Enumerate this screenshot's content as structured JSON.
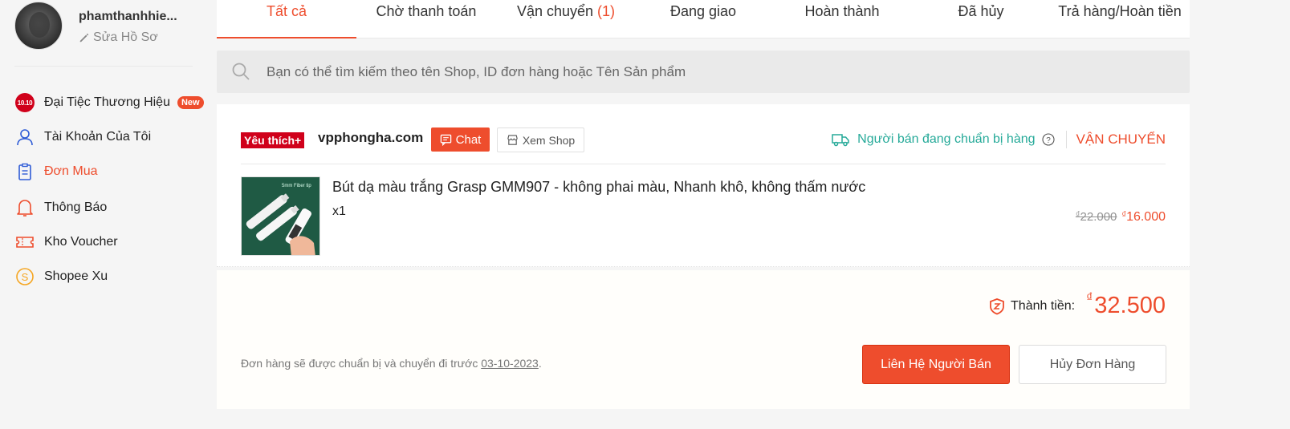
{
  "profile": {
    "username": "phamthanhhie...",
    "edit_label": "Sửa Hồ Sơ"
  },
  "sidebar": {
    "items": [
      {
        "label": "Đại Tiệc Thương Hiệu",
        "icon": "10-10-icon",
        "badge": "New",
        "badge_1010_text": "10.10"
      },
      {
        "label": "Tài Khoản Của Tôi",
        "icon": "user-icon"
      },
      {
        "label": "Đơn Mua",
        "icon": "clipboard-icon",
        "active": true
      },
      {
        "label": "Thông Báo",
        "icon": "bell-icon"
      },
      {
        "label": "Kho Voucher",
        "icon": "voucher-icon"
      },
      {
        "label": "Shopee Xu",
        "icon": "coin-icon"
      }
    ]
  },
  "tabs": [
    {
      "label": "Tất cả",
      "active": true
    },
    {
      "label": "Chờ thanh toán"
    },
    {
      "label": "Vận chuyển",
      "count": "(1)"
    },
    {
      "label": "Đang giao"
    },
    {
      "label": "Hoàn thành"
    },
    {
      "label": "Đã hủy"
    },
    {
      "label": "Trả hàng/Hoàn tiền"
    }
  ],
  "search": {
    "placeholder": "Bạn có thể tìm kiếm theo tên Shop, ID đơn hàng hoặc Tên Sản phẩm"
  },
  "order": {
    "favorite_badge": "Yêu thích+",
    "shop_name": "vpphongha.com",
    "chat_label": "Chat",
    "view_shop_label": "Xem Shop",
    "status_text": "Người bán đang chuẩn bị hàng",
    "status_label": "VẬN CHUYỂN",
    "product": {
      "name": "Bút dạ màu trắng Grasp GMM907 - không phai màu, Nhanh khô, không thấm nước",
      "quantity": "x1",
      "currency": "₫",
      "old_price": "22.000",
      "new_price": "16.000",
      "thumbnail_caption": "5mm Fiber tip"
    },
    "total_label": "Thành tiền:",
    "currency": "₫",
    "total_value": "32.500",
    "ship_note_prefix": "Đơn hàng sẽ được chuẩn bị và chuyển đi trước ",
    "ship_date": "03-10-2023",
    "ship_note_suffix": ".",
    "contact_seller_label": "Liên Hệ Người Bán",
    "cancel_order_label": "Hủy Đơn Hàng"
  },
  "colors": {
    "accent": "#ee4d2d",
    "status_teal": "#26aa99",
    "favorite_red": "#d0011b"
  }
}
